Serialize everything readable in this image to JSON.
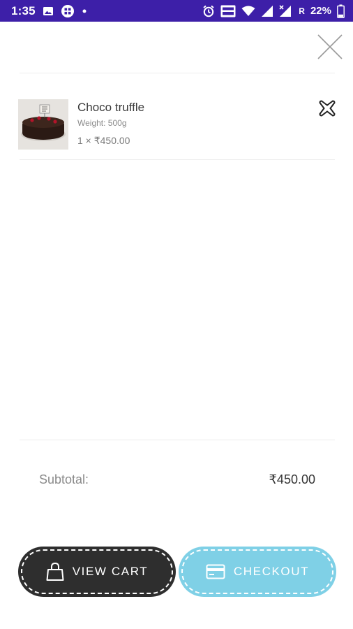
{
  "status_bar": {
    "time": "1:35",
    "icons": [
      "image-icon",
      "grid-app-icon",
      "dot-icon",
      "alarm-icon",
      "volte-icon",
      "wifi-icon",
      "signal-icon",
      "signal-x-icon"
    ],
    "roaming": "R",
    "battery_text": "22%",
    "color": "#3d1fa8"
  },
  "cart": {
    "close_icon": "close-icon",
    "items": [
      {
        "title": "Choco truffle",
        "weight": "Weight: 500g",
        "qty_price": "1 × ₹450.00",
        "remove_icon": "remove-icon"
      }
    ]
  },
  "summary": {
    "subtotal_label": "Subtotal:",
    "subtotal_value": "₹450.00"
  },
  "actions": {
    "view_cart_label": "VIEW CART",
    "checkout_label": "CHECKOUT",
    "view_cart_icon": "shopping-bag-icon",
    "checkout_icon": "credit-card-icon",
    "view_cart_color": "#2e2e2e",
    "checkout_color": "#7fd0e6"
  }
}
